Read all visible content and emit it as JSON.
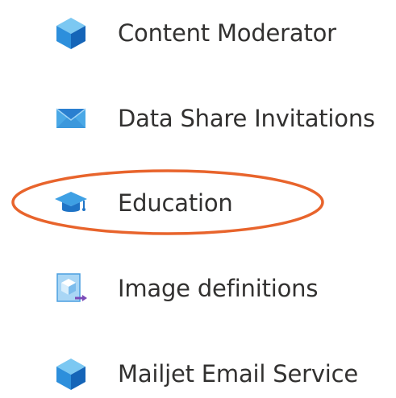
{
  "services": [
    {
      "label": "Content Moderator",
      "icon": "cube-icon"
    },
    {
      "label": "Data Share Invitations",
      "icon": "envelope-icon"
    },
    {
      "label": "Education",
      "icon": "graduation-cap-icon"
    },
    {
      "label": "Image definitions",
      "icon": "image-definition-icon"
    },
    {
      "label": "Mailjet Email Service",
      "icon": "cube-icon"
    }
  ],
  "highlight": {
    "target": "Education",
    "color": "#e8642c"
  },
  "colors": {
    "text": "#323130",
    "icon_blue_light": "#50b4ec",
    "icon_blue_dark": "#1e73c8",
    "annotation": "#e8642c"
  }
}
